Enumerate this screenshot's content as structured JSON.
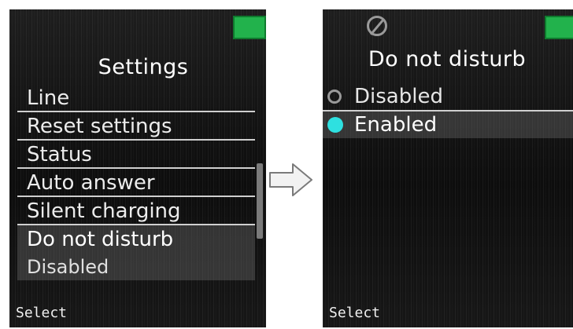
{
  "left_screen": {
    "title": "Settings",
    "menu_items": [
      {
        "label": "Line"
      },
      {
        "label": "Reset settings"
      },
      {
        "label": "Status"
      },
      {
        "label": "Auto answer"
      },
      {
        "label": "Silent charging"
      },
      {
        "label": "Do not disturb",
        "selected": true
      }
    ],
    "selected_value": "Disabled",
    "softkey": "Select"
  },
  "right_screen": {
    "status_icon": "do-not-disturb-icon",
    "title": "Do not disturb",
    "options": [
      {
        "label": "Disabled",
        "selected": false
      },
      {
        "label": "Enabled",
        "selected": true
      }
    ],
    "softkey": "Select"
  },
  "colors": {
    "battery": "#22b24c",
    "radio_selected": "#2ee0e0",
    "screen_bg": "#141414"
  }
}
